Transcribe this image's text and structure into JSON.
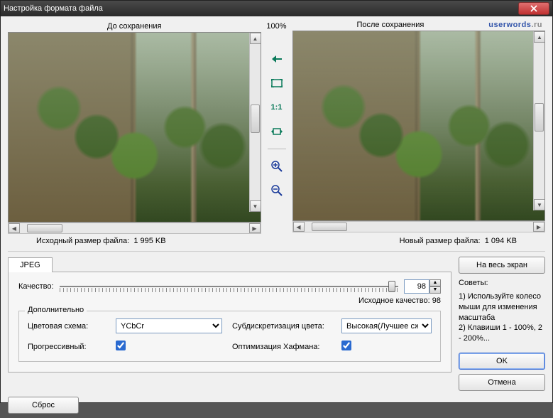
{
  "window": {
    "title": "Настройка формата файла"
  },
  "preview": {
    "before_label": "До сохранения",
    "after_label": "После сохранения",
    "zoom_label": "100%",
    "watermark_1": "userwords",
    "watermark_2": ".ru",
    "ratio_label": "1:1"
  },
  "sizes": {
    "src_label": "Исходный размер файла:",
    "src_value": "1 995 KB",
    "new_label": "Новый размер файла:",
    "new_value": "1 094 KB"
  },
  "tabs": {
    "jpeg": "JPEG"
  },
  "fullscreen_btn": "На весь экран",
  "quality": {
    "label": "Качество:",
    "value": "98",
    "src_label": "Исходное качество: 98"
  },
  "advanced": {
    "legend": "Дополнительно",
    "color_scheme_label": "Цветовая схема:",
    "color_scheme_value": "YCbCr",
    "subsampling_label": "Субдискретизация цвета:",
    "subsampling_value": "Высокая(Лучшее сжатие)",
    "progressive_label": "Прогрессивный:",
    "huffman_label": "Оптимизация Хафмана:"
  },
  "tips": {
    "title": "Советы:",
    "line1": "1) Используйте колесо мыши для изменения масштаба",
    "line2": "2) Клавиши 1 - 100%, 2 - 200%..."
  },
  "buttons": {
    "ok": "OK",
    "cancel": "Отмена",
    "reset": "Сброс"
  }
}
